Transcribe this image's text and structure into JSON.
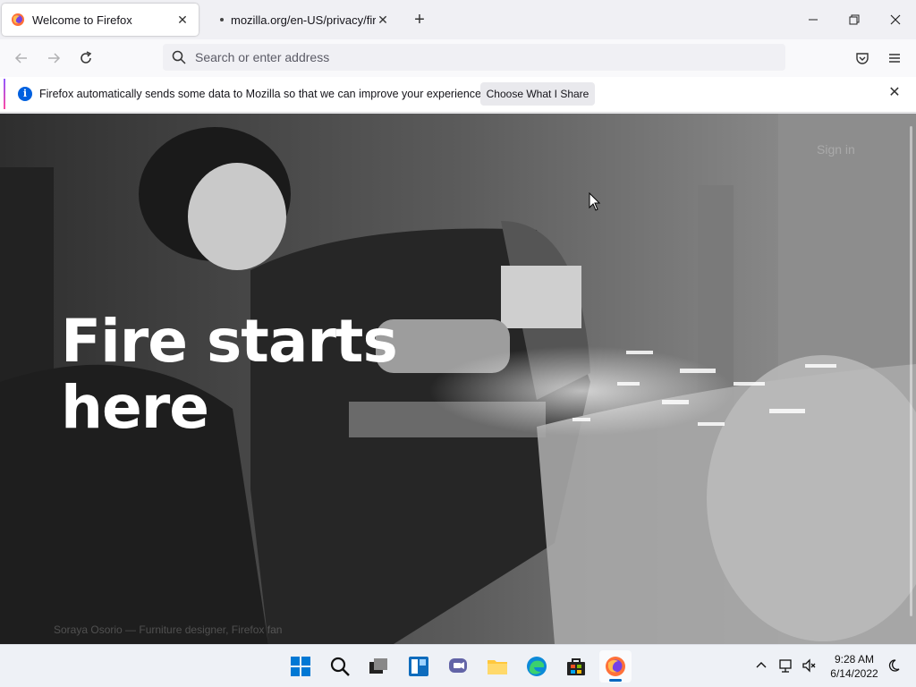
{
  "tabs": [
    {
      "title": "Welcome to Firefox",
      "active": true
    },
    {
      "title": "mozilla.org/en-US/privacy/firefox",
      "active": false
    }
  ],
  "window_controls": {
    "minimize": "minimize-icon",
    "restore": "restore-icon",
    "close": "close-icon"
  },
  "navbar": {
    "search_placeholder": "Search or enter address"
  },
  "notification": {
    "message": "Firefox automatically sends some data to Mozilla so that we can improve your experience.",
    "button": "Choose What I Share"
  },
  "hero": {
    "headline_line1": "Fire starts",
    "headline_line2": "here",
    "sign_in": "Sign in",
    "credit": "Soraya Osorio — Furniture designer, Firefox fan"
  },
  "taskbar": {
    "apps": [
      "start",
      "search",
      "task-view",
      "widgets",
      "chat",
      "file-explorer",
      "edge",
      "store",
      "firefox"
    ],
    "time": "9:28 AM",
    "date": "6/14/2022"
  },
  "colors": {
    "accent": "#0060df",
    "taskbar_indicator": "#0067c0"
  }
}
